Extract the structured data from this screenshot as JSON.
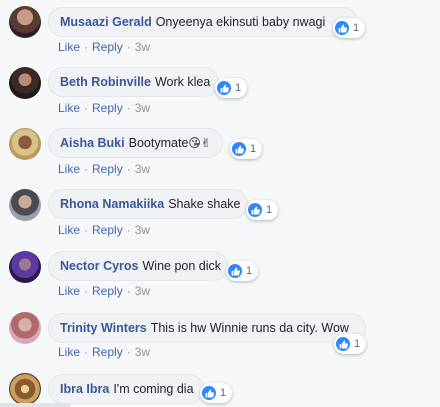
{
  "actions": {
    "like_label": "Like",
    "reply_label": "Reply",
    "separator": "·"
  },
  "like_icon": "thumbs-up-icon",
  "colors": {
    "author": "#385898",
    "link": "#4267b2",
    "like_badge": "#2d88ff",
    "bubble": "#f0f2f5"
  },
  "comments": [
    {
      "author": "Musaazi Gerald",
      "text": "Onyeenya ekinsuti baby nwagi",
      "emoji": "",
      "reaction_count": "1",
      "time": "3w"
    },
    {
      "author": "Beth Robinville",
      "text": "Work klea",
      "emoji": "",
      "reaction_count": "1",
      "time": "3w"
    },
    {
      "author": "Aisha Buki",
      "text": "Bootymate",
      "emoji": "😘✌",
      "reaction_count": "1",
      "time": "3w"
    },
    {
      "author": "Rhona Namakiika",
      "text": "Shake shake",
      "emoji": "",
      "reaction_count": "1",
      "time": "3w"
    },
    {
      "author": "Nector Cyros",
      "text": "Wine pon dick",
      "emoji": "",
      "reaction_count": "1",
      "time": "3w"
    },
    {
      "author": "Trinity Winters",
      "text": "This is hw Winnie runs da city. Wow",
      "emoji": "",
      "reaction_count": "1",
      "time": "3w"
    },
    {
      "author": "Ibra Ibra",
      "text": "I'm coming dia",
      "emoji": "",
      "reaction_count": "1",
      "time": ""
    }
  ]
}
